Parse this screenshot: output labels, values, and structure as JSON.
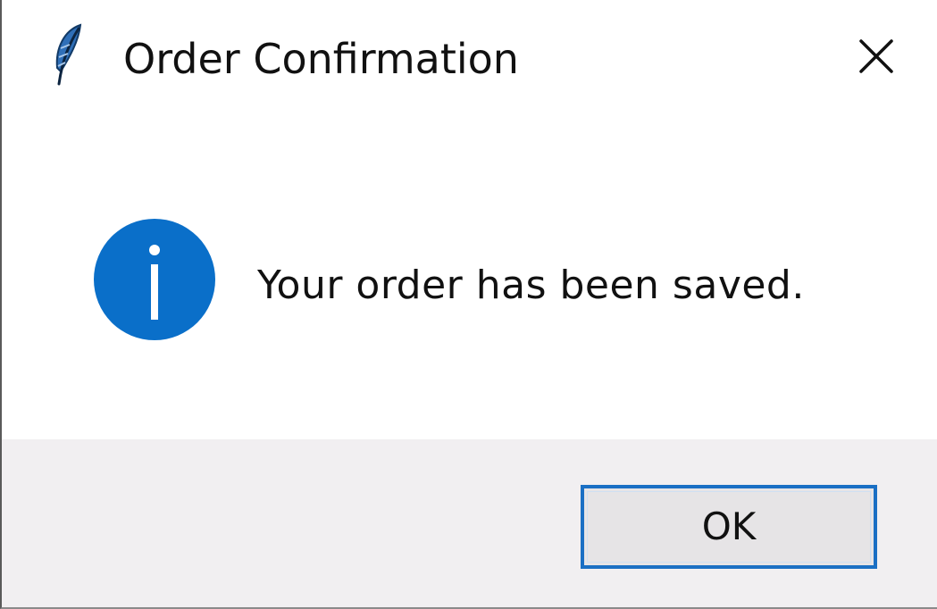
{
  "window": {
    "title": "Order Confirmation",
    "title_icon": "feather-icon",
    "close_icon": "close-icon"
  },
  "content": {
    "icon": "info-icon",
    "message": "Your order has been saved."
  },
  "footer": {
    "ok_label": "OK"
  },
  "colors": {
    "accent": "#0a6fc9",
    "footer_bg": "#f1eff1",
    "button_border": "#1a6fc4"
  }
}
